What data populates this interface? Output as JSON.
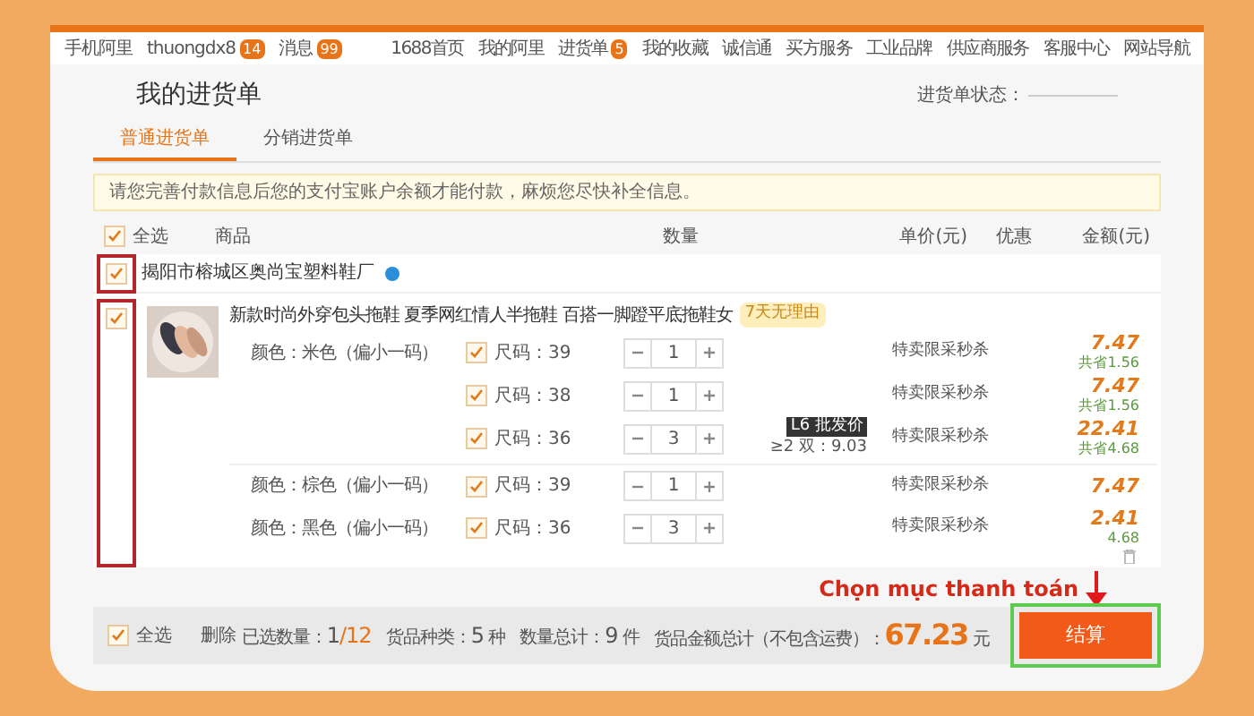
{
  "top_bar": {
    "left": [
      {
        "label": "手机阿里"
      },
      {
        "label": "thuongdx8",
        "badge": "14"
      },
      {
        "label": "消息",
        "badge": "99"
      }
    ],
    "right": [
      {
        "label": "1688首页"
      },
      {
        "label": "我的阿里"
      },
      {
        "label": "进货单",
        "badge": "5"
      },
      {
        "label": "我的收藏"
      },
      {
        "label": "诚信通"
      },
      {
        "label": "买方服务"
      },
      {
        "label": "工业品牌"
      },
      {
        "label": "供应商服务"
      },
      {
        "label": "客服中心"
      },
      {
        "label": "网站导航"
      }
    ]
  },
  "page_title": "我的进货单",
  "cart_status_label": "进货单状态：",
  "tabs": [
    {
      "label": "普通进货单",
      "selected": true
    },
    {
      "label": "分销进货单",
      "selected": false
    }
  ],
  "notice": "请您完善付款信息后您的支付宝账户余额才能付款，麻烦您尽快补全信息。",
  "columns": {
    "select_all": "全选",
    "select_all_checked": true,
    "product": "商品",
    "quantity": "数量",
    "unit_price": "单价(元)",
    "discount": "优惠",
    "amount": "金额(元)"
  },
  "supplier": {
    "name": "揭阳市榕城区奥尚宝塑料鞋厂",
    "checked": true
  },
  "product": {
    "title": "新款时尚外穿包头拖鞋 夏季网红情人半拖鞋 百搭一脚蹬平底拖鞋女",
    "tag": "7天无理由",
    "checked": true,
    "variants": [
      {
        "color_option": "颜色：米色（偏小一码）",
        "size": "尺码：39",
        "checked": true,
        "qty": "1",
        "discount": "特卖限采秒杀",
        "amount": "7.47",
        "saved": "共省1.56"
      },
      {
        "size": "尺码：38",
        "checked": true,
        "qty": "1",
        "discount": "特卖限采秒杀",
        "amount": "7.47",
        "saved": "共省1.56"
      },
      {
        "size": "尺码：36",
        "checked": true,
        "qty": "3",
        "price_badge": "L6 批发价",
        "price_tier": "≥2 双：9.03",
        "discount": "特卖限采秒杀",
        "amount": "22.41",
        "saved": "共省4.68"
      },
      {
        "color_option": "颜色：棕色（偏小一码）",
        "size": "尺码：39",
        "checked": true,
        "qty": "1",
        "discount": "特卖限采秒杀",
        "amount": "7.47"
      },
      {
        "color_option": "颜色：黑色（偏小一码）",
        "size": "尺码：36",
        "checked": true,
        "qty": "3",
        "discount": "特卖限采秒杀",
        "amount": "2.41",
        "saved": "4.68"
      }
    ]
  },
  "footer": {
    "select_all": "全选",
    "select_all_checked": true,
    "delete": "删除",
    "selected_label": "已选数量：",
    "selected": "1",
    "selected_total": "/12",
    "kinds_label": "货品种类：",
    "kinds": "5",
    "kinds_unit": "种",
    "count_label": "数量总计：",
    "count": "9",
    "count_unit": "件",
    "total_label": "货品金额总计（不包含运费）：",
    "total": "67.23",
    "total_unit": "元",
    "checkout": "结算"
  },
  "annotation": "Chọn mục thanh toán"
}
